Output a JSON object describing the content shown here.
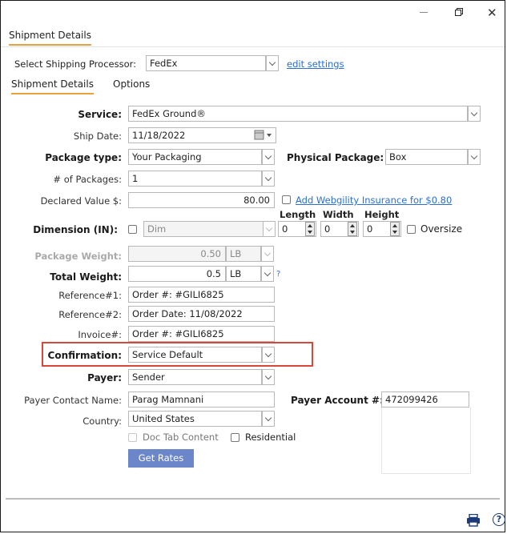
{
  "window": {
    "title_tab": "Shipment Details"
  },
  "processor": {
    "label": "Select Shipping Processor:",
    "value": "FedEx",
    "edit_link": "edit settings"
  },
  "tabs": [
    "Shipment Details",
    "Options"
  ],
  "form": {
    "service": {
      "label": "Service:",
      "value": "FedEx Ground®"
    },
    "ship_date": {
      "label": "Ship Date:",
      "value": "11/18/2022"
    },
    "package_type": {
      "label": "Package type:",
      "value": "Your Packaging"
    },
    "physical_package": {
      "label": "Physical Package:",
      "value": "Box"
    },
    "num_packages": {
      "label": "# of Packages:",
      "value": "1"
    },
    "declared_value": {
      "label": "Declared Value $:",
      "value": "80.00",
      "insurance_link": "Add Webgility Insurance for $0.80"
    },
    "dimension": {
      "label": "Dimension (IN):",
      "placeholder": "Dim",
      "length_label": "Length",
      "width_label": "Width",
      "height_label": "Height",
      "length": "0",
      "width": "0",
      "height": "0",
      "oversize_label": "Oversize"
    },
    "package_weight": {
      "label": "Package Weight:",
      "value": "0.50",
      "unit": "LB"
    },
    "total_weight": {
      "label": "Total Weight:",
      "value": "0.5",
      "unit": "LB",
      "help": "?"
    },
    "reference1": {
      "label": "Reference#1:",
      "value": "Order #:  #GILI6825"
    },
    "reference2": {
      "label": "Reference#2:",
      "value": "Order Date:  11/08/2022"
    },
    "invoice": {
      "label": "Invoice#:",
      "value": "Order #:  #GILI6825"
    },
    "confirmation": {
      "label": "Confirmation:",
      "value": "Service Default"
    },
    "payer": {
      "label": "Payer:",
      "value": "Sender"
    },
    "payer_contact": {
      "label": "Payer Contact Name:",
      "value": "Parag Mamnani"
    },
    "payer_account": {
      "label": "Payer Account #:",
      "value": "472099426"
    },
    "country": {
      "label": "Country:",
      "value": "United States"
    },
    "doc_tab": {
      "label": "Doc Tab Content"
    },
    "residential": {
      "label": "Residential"
    },
    "get_rates": "Get Rates"
  },
  "colors": {
    "accent_tab": "#e8a23c",
    "highlight_box": "#d9473b",
    "button": "#6b86c9",
    "link": "#2a6fd1"
  },
  "icons": [
    "maximize-icon",
    "close-icon",
    "calendar-icon",
    "print-icon",
    "help-icon"
  ]
}
